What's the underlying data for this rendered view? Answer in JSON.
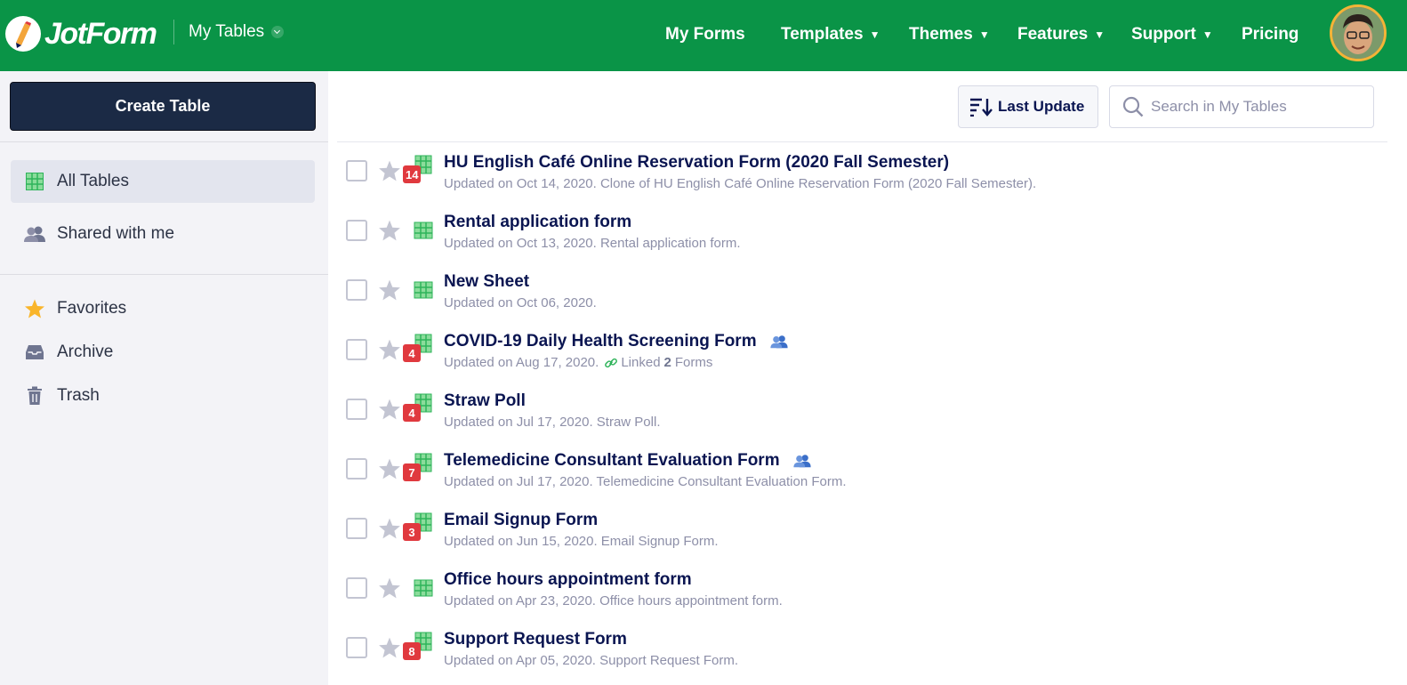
{
  "header": {
    "logo_text": "JotForm",
    "section_label": "My Tables",
    "nav": [
      {
        "label": "My Forms",
        "caret": ""
      },
      {
        "label": "Templates",
        "caret": "▼"
      },
      {
        "label": "Themes",
        "caret": "▼"
      },
      {
        "label": "Features",
        "caret": "▼"
      },
      {
        "label": "Support",
        "caret": "▼"
      },
      {
        "label": "Pricing",
        "caret": ""
      }
    ]
  },
  "sidebar": {
    "create_label": "Create Table",
    "items": [
      {
        "label": "All Tables",
        "icon": "grid-icon",
        "active": true
      },
      {
        "label": "Shared with me",
        "icon": "users-icon",
        "active": false
      },
      {
        "label": "Favorites",
        "icon": "star-icon",
        "active": false
      },
      {
        "label": "Archive",
        "icon": "inbox-icon",
        "active": false
      },
      {
        "label": "Trash",
        "icon": "trash-icon",
        "active": false
      }
    ]
  },
  "toolbar": {
    "sort_label": "Last Update",
    "search_placeholder": "Search in My Tables"
  },
  "tables": [
    {
      "title": "HU English Café Online Reservation Form (2020 Fall Semester)",
      "subtitle": "Updated on Oct 14, 2020. Clone of HU English Café Online Reservation Form (2020 Fall Semester).",
      "badge": "14",
      "shared": false
    },
    {
      "title": "Rental application form",
      "subtitle": "Updated on Oct 13, 2020. Rental application form.",
      "badge": "",
      "shared": false
    },
    {
      "title": "New Sheet",
      "subtitle": "Updated on Oct 06, 2020.",
      "badge": "",
      "shared": false
    },
    {
      "title": "COVID-19 Daily Health Screening Form",
      "subtitle": "Updated on Aug 17, 2020.",
      "badge": "4",
      "shared": true,
      "linked": {
        "prefix": "Linked",
        "count": "2",
        "suffix": "Forms"
      }
    },
    {
      "title": "Straw Poll",
      "subtitle": "Updated on Jul 17, 2020. Straw Poll.",
      "badge": "4",
      "shared": false
    },
    {
      "title": "Telemedicine Consultant Evaluation Form",
      "subtitle": "Updated on Jul 17, 2020. Telemedicine Consultant Evaluation Form.",
      "badge": "7",
      "shared": true
    },
    {
      "title": "Email Signup Form",
      "subtitle": "Updated on Jun 15, 2020. Email Signup Form.",
      "badge": "3",
      "shared": false
    },
    {
      "title": "Office hours appointment form",
      "subtitle": "Updated on Apr 23, 2020. Office hours appointment form.",
      "badge": "",
      "shared": false
    },
    {
      "title": "Support Request Form",
      "subtitle": "Updated on Apr 05, 2020. Support Request Form.",
      "badge": "8",
      "shared": false
    }
  ],
  "colors": {
    "brand_green": "#0a9447",
    "sidebar_bg": "#f3f3f7",
    "create_button": "#1b2a45",
    "badge_red": "#e0393e",
    "shared_blue": "#4a7fd4"
  }
}
